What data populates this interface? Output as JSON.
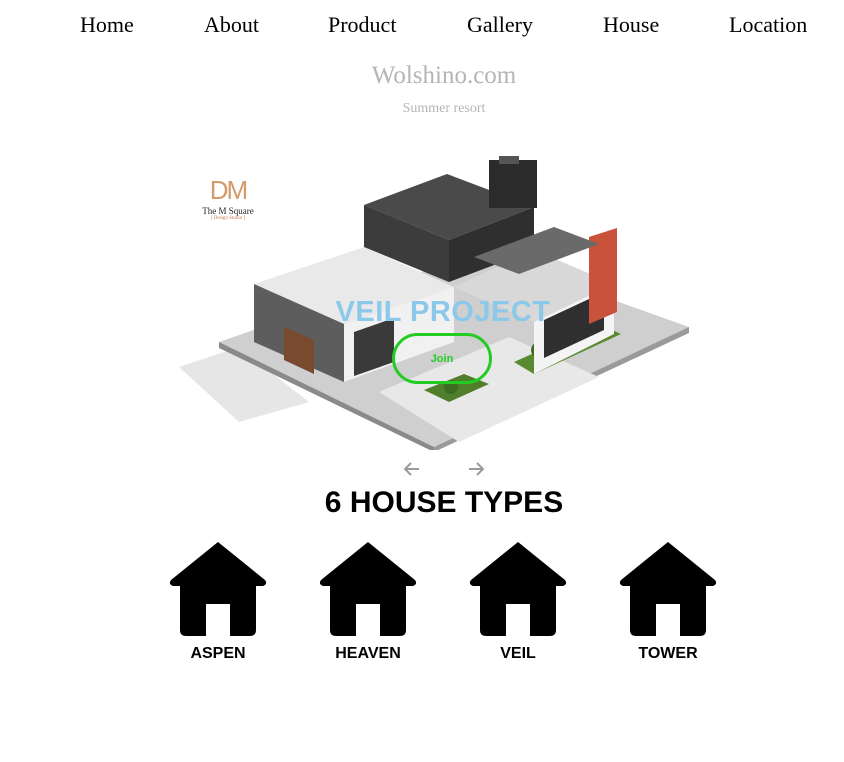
{
  "nav": {
    "items": [
      {
        "label": "Home"
      },
      {
        "label": "About"
      },
      {
        "label": "Product"
      },
      {
        "label": "Gallery"
      },
      {
        "label": "House"
      },
      {
        "label": "Location"
      }
    ]
  },
  "brand": {
    "title": "Wolshino.com",
    "tagline": "Summer resort"
  },
  "hero": {
    "logo": {
      "mark": "D",
      "mark_accent": "M",
      "name": "The M Square",
      "sub": "[ Design Studio ]"
    },
    "title": "VEIL PROJECT",
    "button_label": "Join",
    "prev_icon": "arrow-left-icon",
    "next_icon": "arrow-right-icon"
  },
  "house_types": {
    "title": "6 HOUSE TYPES",
    "icon": "house-icon",
    "items": [
      {
        "label": "ASPEN"
      },
      {
        "label": "HEAVEN"
      },
      {
        "label": "VEIL"
      },
      {
        "label": "TOWER"
      }
    ]
  },
  "colors": {
    "brand_text": "#b5b5b5",
    "hero_title": "#8cc8ea",
    "join_button": "#22cc22"
  }
}
